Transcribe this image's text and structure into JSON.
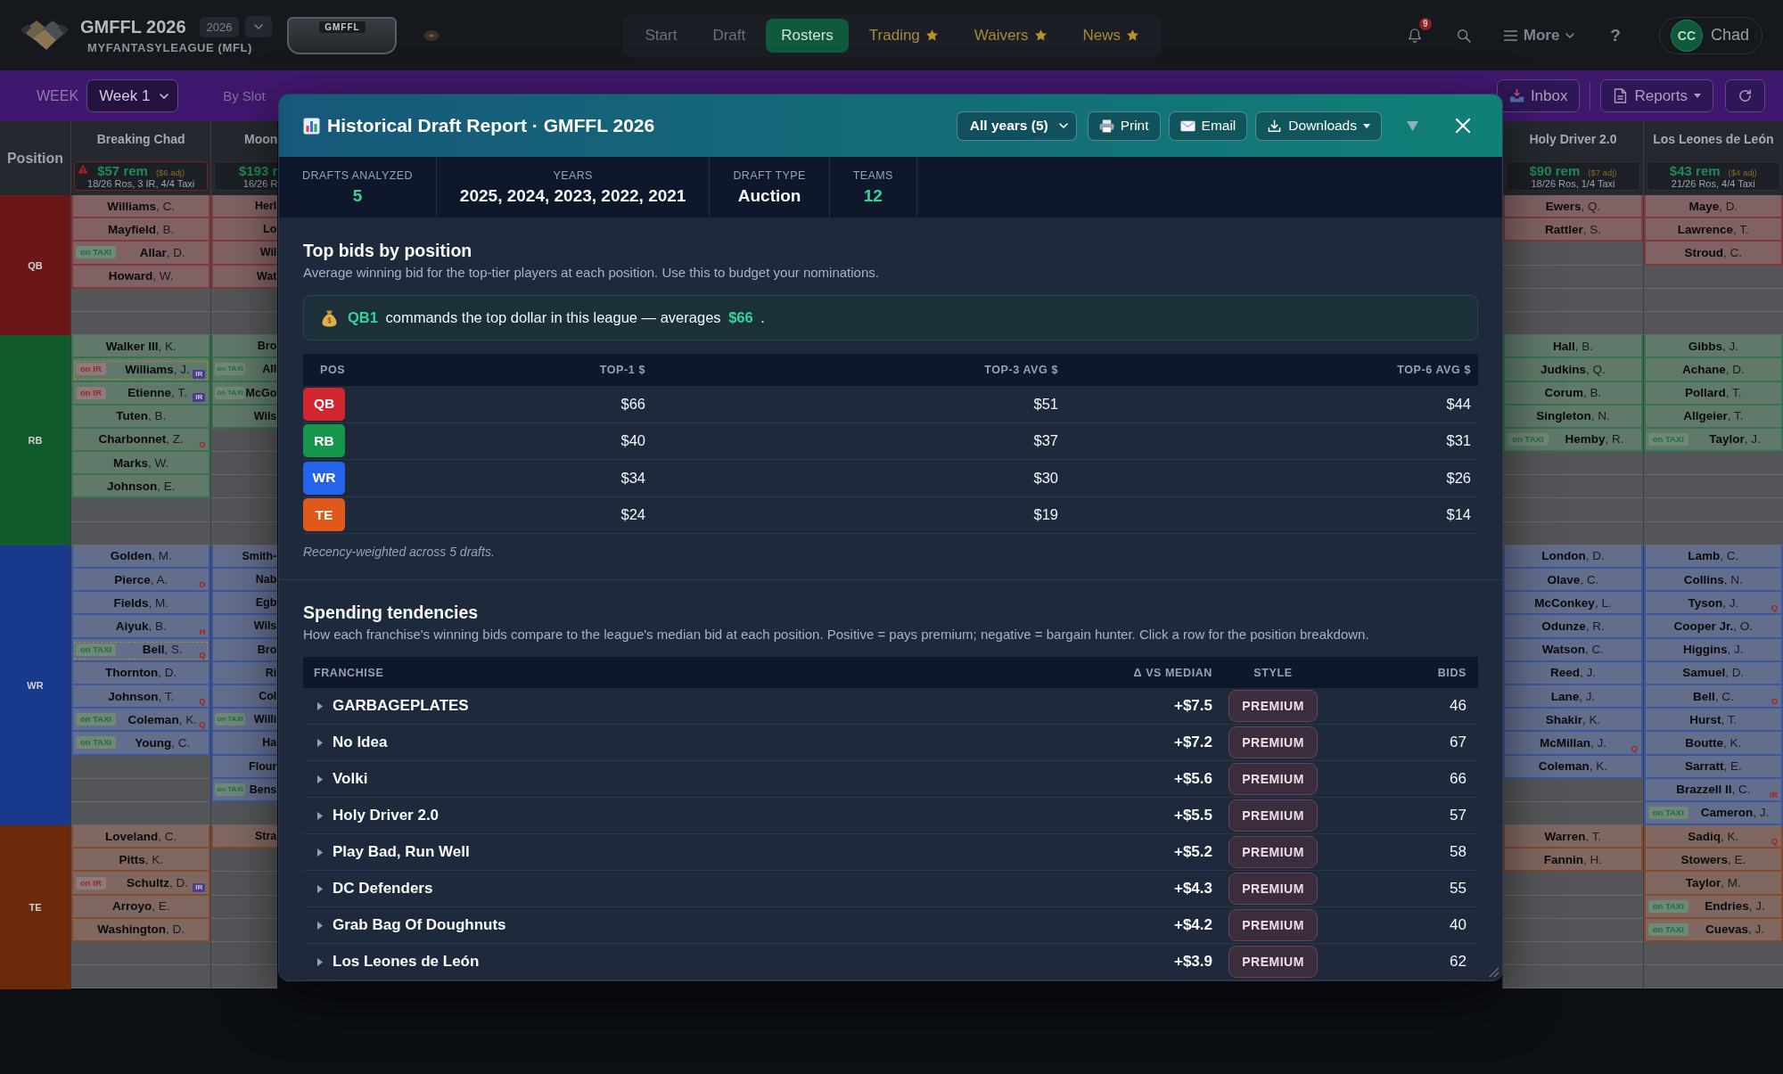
{
  "header": {
    "title": "GMFFL 2026",
    "season": "2026",
    "subtitle": "MYFANTASYLEAGUE (MFL)",
    "banner_text": "GMFFL",
    "nav": [
      {
        "label": "Start",
        "selected": false,
        "starred": false
      },
      {
        "label": "Draft",
        "selected": false,
        "starred": false
      },
      {
        "label": "Rosters",
        "selected": true,
        "starred": false
      },
      {
        "label": "Trading",
        "selected": false,
        "starred": true
      },
      {
        "label": "Waivers",
        "selected": false,
        "starred": true
      },
      {
        "label": "News",
        "selected": false,
        "starred": true
      }
    ],
    "notifications": "9",
    "more": "More",
    "help": "?",
    "user": {
      "initials": "CC",
      "name": "Chad"
    }
  },
  "toolbar": {
    "week_label": "WEEK",
    "week": "Week 1",
    "view": "By Slot",
    "inbox": "Inbox",
    "reports": "Reports"
  },
  "roster": {
    "position_header": "Position",
    "positions": [
      {
        "label": "QB",
        "color": "#6b1717"
      },
      {
        "label": "RB",
        "color": "#105a2b"
      },
      {
        "label": "WR",
        "color": "#18398c"
      },
      {
        "label": "TE",
        "color": "#6c2a0a"
      }
    ],
    "teams": [
      {
        "name": "Breaking Chad",
        "kind": "full",
        "warning": true,
        "remaining": "$57 rem",
        "adjust": "($6 adj)",
        "summary": "18/26 Ros, 3 IR, 4/4 Taxi",
        "groups": [
          [
            {
              "kind": "player",
              "name": "**Williams**, C.",
              "highlighted": false
            },
            {
              "kind": "player",
              "name": "**Mayfield**, B.",
              "highlighted": false
            },
            {
              "kind": "player",
              "name": "**Allar**, D.",
              "highlighted": false,
              "tag": {
                "kind": "taxi",
                "text": "on TAXI"
              }
            },
            {
              "kind": "player",
              "name": "**Howard**, W.",
              "highlighted": false
            },
            {
              "kind": "empty"
            },
            {
              "kind": "empty"
            }
          ],
          [
            {
              "kind": "player",
              "name": "**Walker III**, K.",
              "highlighted": false
            },
            {
              "kind": "player",
              "name": "**Williams**, J.",
              "highlighted": true,
              "tag": {
                "kind": "ir",
                "text": "on IR"
              },
              "badge": "IR"
            },
            {
              "kind": "player",
              "name": "**Etienne**, T.",
              "highlighted": false,
              "tag": {
                "kind": "ir",
                "text": "on IR"
              },
              "badge": "IR"
            },
            {
              "kind": "player",
              "name": "**Tuten**, B.",
              "highlighted": false
            },
            {
              "kind": "player",
              "name": "**Charbonnet**, Z.",
              "highlighted": false,
              "status": "O"
            },
            {
              "kind": "player",
              "name": "**Marks**, W.",
              "highlighted": false
            },
            {
              "kind": "player",
              "name": "**Johnson**, E.",
              "highlighted": false
            },
            {
              "kind": "empty"
            },
            {
              "kind": "empty"
            }
          ],
          [
            {
              "kind": "player",
              "name": "**Golden**, M.",
              "highlighted": false
            },
            {
              "kind": "player",
              "name": "**Pierce**, A.",
              "highlighted": false,
              "status": "O"
            },
            {
              "kind": "player",
              "name": "**Fields**, M.",
              "highlighted": false
            },
            {
              "kind": "player",
              "name": "**Aiyuk**, B.",
              "highlighted": false,
              "status": "H"
            },
            {
              "kind": "player",
              "name": "**Bell**, S.",
              "highlighted": true,
              "tag": {
                "kind": "taxi",
                "text": "on TAXI"
              },
              "status": "Q"
            },
            {
              "kind": "player",
              "name": "**Thornton**, D.",
              "highlighted": false
            },
            {
              "kind": "player",
              "name": "**Johnson**, T.",
              "highlighted": false,
              "status": "Q"
            },
            {
              "kind": "player",
              "name": "**Coleman**, K.",
              "highlighted": false,
              "tag": {
                "kind": "taxi",
                "text": "on TAXI"
              },
              "status": "Q"
            },
            {
              "kind": "player",
              "name": "**Young**, C.",
              "highlighted": false,
              "tag": {
                "kind": "taxi",
                "text": "on TAXI"
              }
            },
            {
              "kind": "empty"
            },
            {
              "kind": "empty"
            },
            {
              "kind": "empty"
            }
          ],
          [
            {
              "kind": "player",
              "name": "**Loveland**, C.",
              "highlighted": false
            },
            {
              "kind": "player",
              "name": "**Pitts**, K.",
              "highlighted": false
            },
            {
              "kind": "player",
              "name": "**Schultz**, D.",
              "highlighted": false,
              "tag": {
                "kind": "ir",
                "text": "on IR"
              },
              "badge": "IR"
            },
            {
              "kind": "player",
              "name": "**Arroyo**, E.",
              "highlighted": false
            },
            {
              "kind": "player",
              "name": "**Washington**, D.",
              "highlighted": false
            },
            {
              "kind": "empty"
            },
            {
              "kind": "empty"
            }
          ]
        ]
      },
      {
        "name": "Moon",
        "kind": "partial",
        "warning": false,
        "remaining": "$193 r",
        "summary": "16/26 R",
        "groups": [
          [
            {
              "kind": "player",
              "name": "**Herl**",
              "highlighted": false
            },
            {
              "kind": "player",
              "name": "**Lo**",
              "highlighted": false
            },
            {
              "kind": "player",
              "name": "**Wil**",
              "highlighted": false
            },
            {
              "kind": "player",
              "name": "**Wat**",
              "highlighted": false
            },
            {
              "kind": "empty"
            },
            {
              "kind": "empty"
            }
          ],
          [
            {
              "kind": "player",
              "name": "**Bro**",
              "highlighted": false
            },
            {
              "kind": "player",
              "name": "**All**",
              "highlighted": false,
              "tag": {
                "kind": "taxi",
                "text": "on TAXI"
              }
            },
            {
              "kind": "player",
              "name": "**McGo**",
              "highlighted": false,
              "tag": {
                "kind": "taxi",
                "text": "on TAXI"
              }
            },
            {
              "kind": "player",
              "name": "**Wils**",
              "highlighted": false
            },
            {
              "kind": "empty"
            },
            {
              "kind": "empty"
            },
            {
              "kind": "empty"
            },
            {
              "kind": "empty"
            },
            {
              "kind": "empty"
            }
          ],
          [
            {
              "kind": "player",
              "name": "**Smith-**",
              "highlighted": false
            },
            {
              "kind": "player",
              "name": "**Nab**",
              "highlighted": false
            },
            {
              "kind": "player",
              "name": "**Egb**",
              "highlighted": false
            },
            {
              "kind": "player",
              "name": "**Wils**",
              "highlighted": false
            },
            {
              "kind": "player",
              "name": "**Bro**",
              "highlighted": false
            },
            {
              "kind": "player",
              "name": "**Ri**",
              "highlighted": false
            },
            {
              "kind": "player",
              "name": "**Col**",
              "highlighted": false
            },
            {
              "kind": "player",
              "name": "**Willi**",
              "highlighted": false,
              "tag": {
                "kind": "taxi",
                "text": "on TAXI"
              }
            },
            {
              "kind": "player",
              "name": "**Ha**",
              "highlighted": false
            },
            {
              "kind": "player",
              "name": "**Flour**",
              "highlighted": false
            },
            {
              "kind": "player",
              "name": "**Bens**",
              "highlighted": false,
              "tag": {
                "kind": "taxi",
                "text": "on TAXI"
              }
            },
            {
              "kind": "empty"
            }
          ],
          [
            {
              "kind": "player",
              "name": "**Stra**",
              "highlighted": false
            },
            {
              "kind": "empty"
            },
            {
              "kind": "empty"
            },
            {
              "kind": "empty"
            },
            {
              "kind": "empty"
            },
            {
              "kind": "empty"
            },
            {
              "kind": "empty"
            }
          ]
        ]
      },
      {
        "name": "Holy Driver 2.0",
        "kind": "full",
        "warning": false,
        "remaining": "$90 rem",
        "adjust": "($7 adj)",
        "summary": "18/26 Ros, 1/4 Taxi",
        "groups": [
          [
            {
              "kind": "player",
              "name": "**Ewers**, Q.",
              "highlighted": false
            },
            {
              "kind": "player",
              "name": "**Rattler**, S.",
              "highlighted": false
            },
            {
              "kind": "empty"
            },
            {
              "kind": "empty"
            },
            {
              "kind": "empty"
            },
            {
              "kind": "empty"
            }
          ],
          [
            {
              "kind": "player",
              "name": "**Hall**, B.",
              "highlighted": false
            },
            {
              "kind": "player",
              "name": "**Judkins**, Q.",
              "highlighted": false
            },
            {
              "kind": "player",
              "name": "**Corum**, B.",
              "highlighted": false
            },
            {
              "kind": "player",
              "name": "**Singleton**, N.",
              "highlighted": false
            },
            {
              "kind": "player",
              "name": "**Hemby**, R.",
              "highlighted": false,
              "tag": {
                "kind": "taxi",
                "text": "on TAXI"
              }
            },
            {
              "kind": "empty"
            },
            {
              "kind": "empty"
            },
            {
              "kind": "empty"
            },
            {
              "kind": "empty"
            }
          ],
          [
            {
              "kind": "player",
              "name": "**London**, D.",
              "highlighted": false
            },
            {
              "kind": "player",
              "name": "**Olave**, C.",
              "highlighted": false
            },
            {
              "kind": "player",
              "name": "**McConkey**, L.",
              "highlighted": false
            },
            {
              "kind": "player",
              "name": "**Odunze**, R.",
              "highlighted": false
            },
            {
              "kind": "player",
              "name": "**Watson**, C.",
              "highlighted": false
            },
            {
              "kind": "player",
              "name": "**Reed**, J.",
              "highlighted": false
            },
            {
              "kind": "player",
              "name": "**Lane**, J.",
              "highlighted": false
            },
            {
              "kind": "player",
              "name": "**Shakir**, K.",
              "highlighted": false
            },
            {
              "kind": "player",
              "name": "**McMillan**, J.",
              "highlighted": false,
              "status": "Q"
            },
            {
              "kind": "player",
              "name": "**Coleman**, K.",
              "highlighted": false
            },
            {
              "kind": "empty"
            },
            {
              "kind": "empty"
            }
          ],
          [
            {
              "kind": "player",
              "name": "**Warren**, T.",
              "highlighted": false
            },
            {
              "kind": "player",
              "name": "**Fannin**, H.",
              "highlighted": false
            },
            {
              "kind": "empty"
            },
            {
              "kind": "empty"
            },
            {
              "kind": "empty"
            },
            {
              "kind": "empty"
            },
            {
              "kind": "empty"
            }
          ]
        ]
      },
      {
        "name": "Los Leones de León",
        "kind": "full",
        "warning": false,
        "remaining": "$43 rem",
        "adjust": "($4 adj)",
        "summary": "21/26 Ros, 4/4 Taxi",
        "groups": [
          [
            {
              "kind": "player",
              "name": "**Maye**, D.",
              "highlighted": false
            },
            {
              "kind": "player",
              "name": "**Lawrence**, T.",
              "highlighted": false
            },
            {
              "kind": "player",
              "name": "**Stroud**, C.",
              "highlighted": false
            },
            {
              "kind": "empty"
            },
            {
              "kind": "empty"
            },
            {
              "kind": "empty"
            }
          ],
          [
            {
              "kind": "player",
              "name": "**Gibbs**, J.",
              "highlighted": false
            },
            {
              "kind": "player",
              "name": "**Achane**, D.",
              "highlighted": false
            },
            {
              "kind": "player",
              "name": "**Pollard**, T.",
              "highlighted": false
            },
            {
              "kind": "player",
              "name": "**Allgeier**, T.",
              "highlighted": false
            },
            {
              "kind": "player",
              "name": "**Taylor**, J.",
              "highlighted": false,
              "tag": {
                "kind": "taxi",
                "text": "on TAXI"
              }
            },
            {
              "kind": "empty"
            },
            {
              "kind": "empty"
            },
            {
              "kind": "empty"
            },
            {
              "kind": "empty"
            }
          ],
          [
            {
              "kind": "player",
              "name": "**Lamb**, C.",
              "highlighted": false
            },
            {
              "kind": "player",
              "name": "**Collins**, N.",
              "highlighted": false
            },
            {
              "kind": "player",
              "name": "**Tyson**, J.",
              "highlighted": false,
              "status": "Q"
            },
            {
              "kind": "player",
              "name": "**Cooper Jr.**, O.",
              "highlighted": false
            },
            {
              "kind": "player",
              "name": "**Higgins**, J.",
              "highlighted": false
            },
            {
              "kind": "player",
              "name": "**Samuel**, D.",
              "highlighted": false
            },
            {
              "kind": "player",
              "name": "**Bell**, C.",
              "highlighted": false,
              "status": "O"
            },
            {
              "kind": "player",
              "name": "**Hurst**, T.",
              "highlighted": false
            },
            {
              "kind": "player",
              "name": "**Boutte**, K.",
              "highlighted": false
            },
            {
              "kind": "player",
              "name": "**Sarratt**, E.",
              "highlighted": false
            },
            {
              "kind": "player",
              "name": "**Brazzell II**, C.",
              "highlighted": false,
              "status": "IR"
            },
            {
              "kind": "player",
              "name": "**Cameron**, J.",
              "highlighted": false,
              "tag": {
                "kind": "taxi",
                "text": "on TAXI"
              }
            }
          ],
          [
            {
              "kind": "player",
              "name": "**Sadiq**, K.",
              "highlighted": false,
              "status": "Q"
            },
            {
              "kind": "player",
              "name": "**Stowers**, E.",
              "highlighted": false
            },
            {
              "kind": "player",
              "name": "**Taylor**, M.",
              "highlighted": false
            },
            {
              "kind": "player",
              "name": "**Endries**, J.",
              "highlighted": false,
              "tag": {
                "kind": "taxi",
                "text": "on TAXI"
              }
            },
            {
              "kind": "player",
              "name": "**Cuevas**, J.",
              "highlighted": false,
              "tag": {
                "kind": "taxi",
                "text": "on TAXI"
              }
            },
            {
              "kind": "empty"
            },
            {
              "kind": "empty"
            }
          ]
        ]
      }
    ]
  },
  "dialog": {
    "title": "Historical Draft Report · GMFFL 2026",
    "years_filter": "All years (5)",
    "actions": [
      {
        "kind": "print",
        "label": "Print",
        "menu": false
      },
      {
        "kind": "email",
        "label": "Email",
        "menu": false
      },
      {
        "kind": "download",
        "label": "Downloads",
        "menu": true
      }
    ],
    "stats": [
      {
        "label": "DRAFTS ANALYZED",
        "value": "5",
        "accent": true
      },
      {
        "label": "YEARS",
        "value": "2025, 2024, 2023, 2022, 2021",
        "accent": false
      },
      {
        "label": "DRAFT TYPE",
        "value": "Auction",
        "accent": false
      },
      {
        "label": "TEAMS",
        "value": "12",
        "accent": true
      }
    ],
    "top_bids": {
      "title": "Top bids by position",
      "description": "Average winning bid for the top-tier players at each position. Use this to budget your nominations.",
      "callout": "**QB1** commands the top dollar in this league — averages **$66** .",
      "columns": [
        "POS",
        "TOP-1 $",
        "TOP-3 AVG $",
        "TOP-6 AVG $"
      ],
      "rows": [
        {
          "position": "QB",
          "color": "#d1262e",
          "top1": "$66",
          "top3": "$51",
          "top6": "$44"
        },
        {
          "position": "RB",
          "color": "#16964b",
          "top1": "$40",
          "top3": "$37",
          "top6": "$31"
        },
        {
          "position": "WR",
          "color": "#2563eb",
          "top1": "$34",
          "top3": "$30",
          "top6": "$26"
        },
        {
          "position": "TE",
          "color": "#e0591a",
          "top1": "$24",
          "top3": "$19",
          "top6": "$14"
        }
      ],
      "footnote": "Recency-weighted across 5 drafts."
    },
    "spending": {
      "title": "Spending tendencies",
      "description": "How each franchise's winning bids compare to the league's median bid at each position. Positive = pays premium; negative = bargain hunter. Click a row for the position breakdown.",
      "columns": [
        "FRANCHISE",
        "Δ VS MEDIAN",
        "STYLE",
        "BIDS"
      ],
      "rows": [
        {
          "name": "GARBAGEPLATES",
          "expanded": false,
          "delta": "+$7.5",
          "style": "PREMIUM",
          "bids": "46"
        },
        {
          "name": "No Idea",
          "expanded": false,
          "delta": "+$7.2",
          "style": "PREMIUM",
          "bids": "67"
        },
        {
          "name": "Volki",
          "expanded": false,
          "delta": "+$5.6",
          "style": "PREMIUM",
          "bids": "66"
        },
        {
          "name": "Holy Driver 2.0",
          "expanded": false,
          "delta": "+$5.5",
          "style": "PREMIUM",
          "bids": "57"
        },
        {
          "name": "Play Bad, Run Well",
          "expanded": false,
          "delta": "+$5.2",
          "style": "PREMIUM",
          "bids": "58"
        },
        {
          "name": "DC Defenders",
          "expanded": false,
          "delta": "+$4.3",
          "style": "PREMIUM",
          "bids": "55"
        },
        {
          "name": "Grab Bag Of Doughnuts",
          "expanded": false,
          "delta": "+$4.2",
          "style": "PREMIUM",
          "bids": "40"
        },
        {
          "name": "Los Leones de León",
          "expanded": false,
          "delta": "+$3.9",
          "style": "PREMIUM",
          "bids": "62"
        }
      ]
    }
  }
}
